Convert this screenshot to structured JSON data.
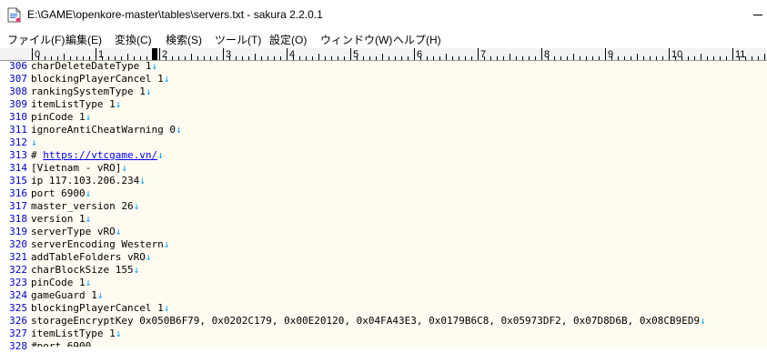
{
  "window": {
    "title": "E:\\GAME\\openkore-master\\tables\\servers.txt - sakura 2.2.0.1"
  },
  "menu": [
    "ファイル(F)",
    "編集(E)",
    "変換(C)",
    "検索(S)",
    "ツール(T)",
    "設定(O)",
    "ウィンドウ(W)",
    "ヘルプ(H)"
  ],
  "ruler": {
    "labels": [
      "0",
      "1",
      "2",
      "3",
      "4",
      "5",
      "6",
      "7",
      "8",
      "9",
      "10",
      "11"
    ],
    "cursor_column": 19
  },
  "eol_mark": "↓",
  "lines": [
    {
      "num": "306",
      "text": "charDeleteDateType 1"
    },
    {
      "num": "307",
      "text": "blockingPlayerCancel 1"
    },
    {
      "num": "308",
      "text": "rankingSystemType 1"
    },
    {
      "num": "309",
      "text": "itemListType 1"
    },
    {
      "num": "310",
      "text": "pinCode 1"
    },
    {
      "num": "311",
      "text": "ignoreAntiCheatWarning 0"
    },
    {
      "num": "312",
      "text": ""
    },
    {
      "num": "313",
      "prefix": "# ",
      "link": "https://vtcgame.vn/"
    },
    {
      "num": "314",
      "text": "[Vietnam - vRO]"
    },
    {
      "num": "315",
      "text": "ip 117.103.206.234"
    },
    {
      "num": "316",
      "text": "port 6900"
    },
    {
      "num": "317",
      "text": "master_version 26"
    },
    {
      "num": "318",
      "text": "version 1"
    },
    {
      "num": "319",
      "text": "serverType vRO"
    },
    {
      "num": "320",
      "text": "serverEncoding Western"
    },
    {
      "num": "321",
      "text": "addTableFolders vRO"
    },
    {
      "num": "322",
      "text": "charBlockSize 155"
    },
    {
      "num": "323",
      "text": "pinCode 1"
    },
    {
      "num": "324",
      "text": "gameGuard 1"
    },
    {
      "num": "325",
      "text": "blockingPlayerCancel 1"
    },
    {
      "num": "326",
      "text": "storageEncryptKey 0x050B6F79, 0x0202C179, 0x00E20120, 0x04FA43E3, 0x0179B6C8, 0x05973DF2, 0x07D8D6B, 0x08CB9ED9"
    },
    {
      "num": "327",
      "text": "itemListType 1"
    },
    {
      "num": "328",
      "text": "#port 6900"
    }
  ]
}
